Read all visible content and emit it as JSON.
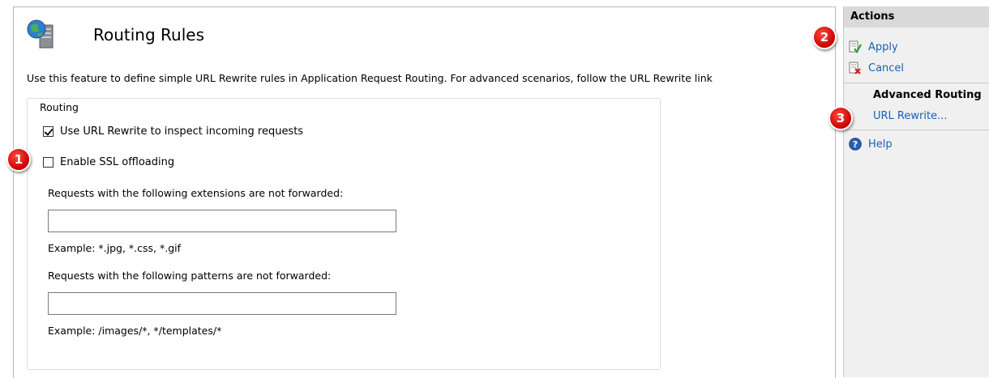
{
  "page": {
    "title": "Routing Rules",
    "description": "Use this feature to define simple URL Rewrite rules in Application Request Routing.  For advanced scenarios, follow the URL Rewrite link"
  },
  "routing": {
    "legend": "Routing",
    "use_url_rewrite": {
      "label": "Use URL Rewrite to inspect incoming requests",
      "checked": true
    },
    "enable_ssl_offloading": {
      "label": "Enable SSL offloading",
      "checked": false
    },
    "extensions": {
      "label": "Requests with the following extensions are not forwarded:",
      "value": "",
      "example": "Example: *.jpg, *.css, *.gif"
    },
    "patterns": {
      "label": "Requests with the following patterns are not forwarded:",
      "value": "",
      "example": "Example: /images/*, */templates/*"
    }
  },
  "actions": {
    "header": "Actions",
    "apply": "Apply",
    "cancel": "Cancel",
    "advanced_routing_title": "Advanced Routing",
    "url_rewrite": "URL Rewrite...",
    "help": "Help"
  },
  "callouts": [
    "1",
    "2",
    "3"
  ],
  "colors": {
    "link": "#1a5fb4",
    "callout": "#d00000",
    "pane_bg": "#f0f0f0"
  }
}
